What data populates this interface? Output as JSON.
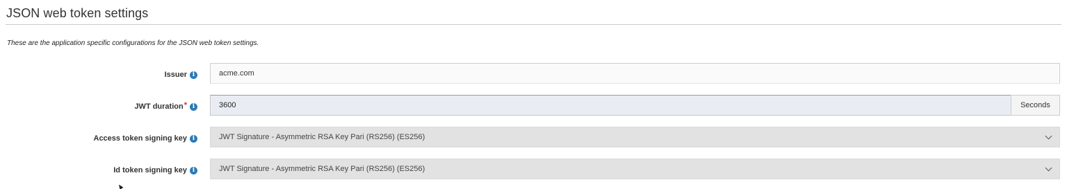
{
  "section": {
    "title": "JSON web token settings",
    "description": "These are the application specific configurations for the JSON web token settings."
  },
  "fields": {
    "issuer": {
      "label": "Issuer",
      "value": "acme.com"
    },
    "jwt_duration": {
      "label": "JWT duration",
      "required_mark": "*",
      "value": "3600",
      "unit": "Seconds"
    },
    "access_token_signing_key": {
      "label": "Access token signing key",
      "selected": "JWT Signature - Asymmetric RSA Key Pari (RS256) (ES256)"
    },
    "id_token_signing_key": {
      "label": "Id token signing key",
      "selected": "JWT Signature - Asymmetric RSA Key Pari (RS256) (ES256)"
    }
  },
  "icons": {
    "info": "info-icon",
    "dropdown": "chevron-down-icon"
  },
  "colors": {
    "info_icon": "#2a7ab8",
    "required": "#c9302c",
    "select_background": "#e2e2e2",
    "focused_input_background": "#e9edf3"
  }
}
